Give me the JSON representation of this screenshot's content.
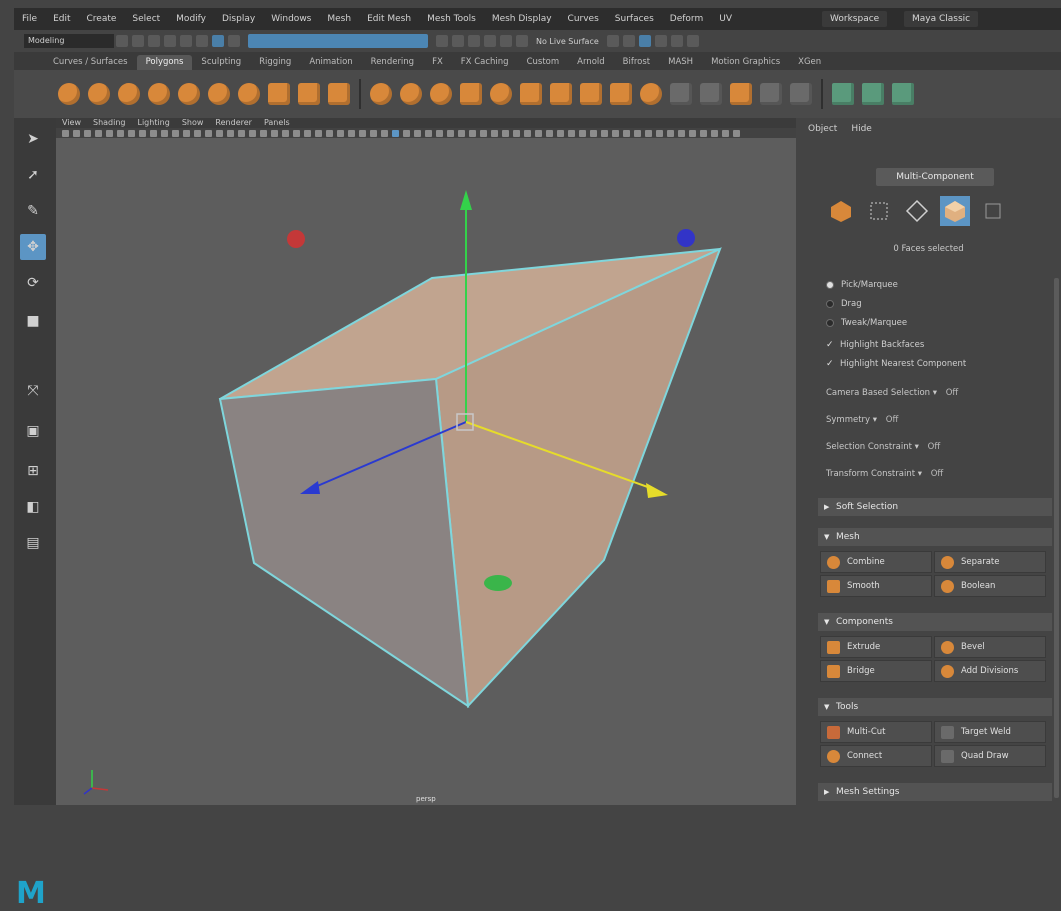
{
  "menu": [
    "File",
    "Edit",
    "Create",
    "Select",
    "Modify",
    "Display",
    "Windows",
    "Mesh",
    "Edit Mesh",
    "Mesh Tools",
    "Mesh Display",
    "Curves",
    "Surfaces",
    "Deform",
    "UV"
  ],
  "workspace": {
    "label": "Workspace",
    "value": "Maya Classic"
  },
  "status_line": {
    "mode": "Modeling",
    "symmetry": "No Live Surface"
  },
  "shelf_tabs": [
    "Curves / Surfaces",
    "Polygons",
    "Sculpting",
    "Rigging",
    "Animation",
    "Rendering",
    "FX",
    "FX Caching",
    "Custom",
    "Arnold",
    "Bifrost",
    "MASH",
    "Motion Graphics",
    "XGen"
  ],
  "shelf_active_tab": "Polygons",
  "viewport": {
    "menu": [
      "View",
      "Shading",
      "Lighting",
      "Show",
      "Renderer",
      "Panels"
    ],
    "camera": "persp"
  },
  "panel": {
    "tabs": [
      "Object",
      "Hide"
    ],
    "mode_button": "Multi-Component",
    "selected_count": "0 Faces selected",
    "radios": [
      "Pick/Marquee",
      "Drag",
      "Tweak/Marquee"
    ],
    "checks": [
      "Highlight Backfaces",
      "Highlight Nearest Component"
    ],
    "options": [
      {
        "label": "Camera Based Selection",
        "value": "Off"
      },
      {
        "label": "Symmetry",
        "value": "Off"
      },
      {
        "label": "Selection Constraint",
        "value": "Off"
      },
      {
        "label": "Transform Constraint",
        "value": "Off"
      }
    ],
    "sections": {
      "soft_selection": "Soft Selection",
      "mesh": "Mesh",
      "components": "Components",
      "tools": "Tools",
      "mesh_settings": "Mesh Settings"
    },
    "mesh_buttons": [
      "Combine",
      "Separate",
      "Smooth",
      "Boolean"
    ],
    "component_buttons": [
      "Extrude",
      "Bevel",
      "Bridge",
      "Add Divisions"
    ],
    "tool_buttons": [
      "Multi-Cut",
      "Target Weld",
      "Connect",
      "Quad Draw"
    ]
  },
  "colors": {
    "accent": "#5c95c4",
    "object_face": "#bfa08c",
    "wireframe": "#7fd6dc",
    "logo": "#1fa3c9"
  }
}
